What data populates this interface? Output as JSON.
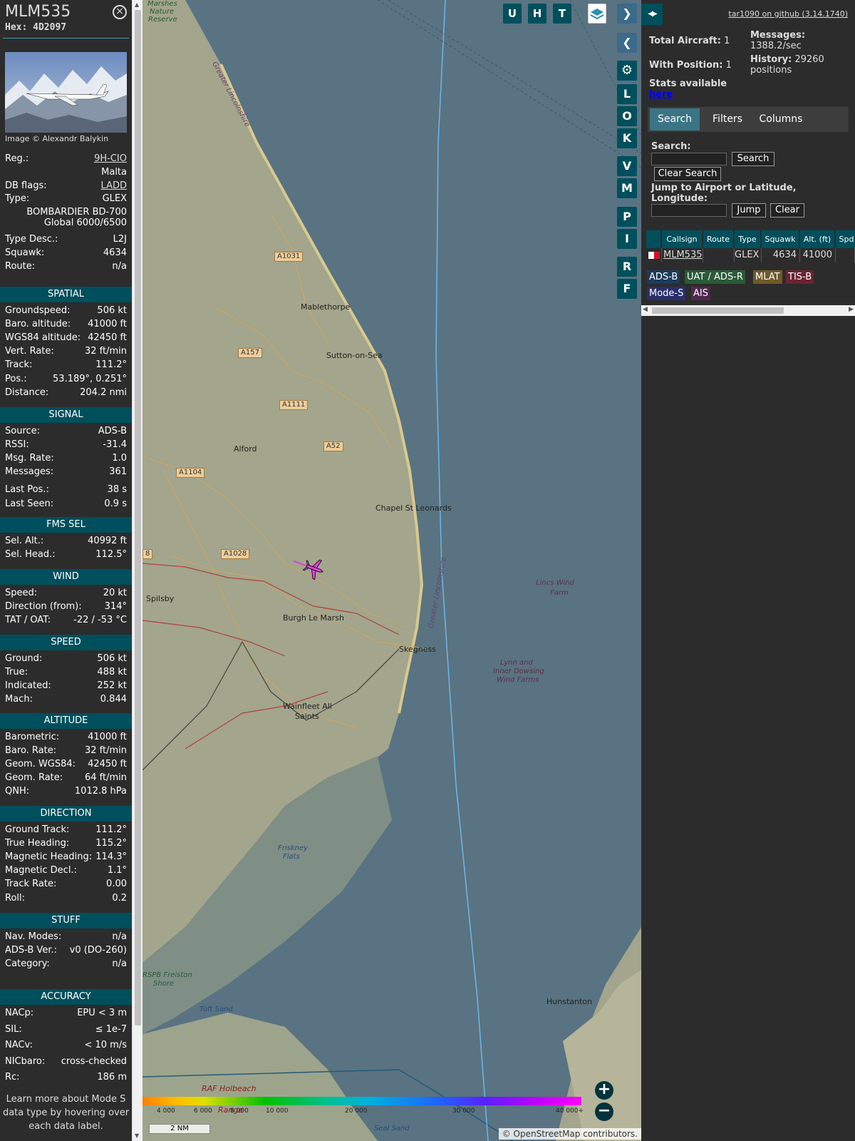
{
  "aircraft": {
    "callsign": "MLM535",
    "hex_label": "Hex:",
    "hex": "4D2097",
    "close_glyph": "×",
    "image_credit": "Image © Alexandr Balykin",
    "reg_label": "Reg.:",
    "reg": "9H-CIO",
    "country": "Malta",
    "dbflags_label": "DB flags:",
    "dbflags": "LADD",
    "type_label": "Type:",
    "type": "GLEX",
    "type_full_1": "BOMBARDIER BD-700",
    "type_full_2": "Global 6000/6500",
    "type_desc_label": "Type Desc.:",
    "type_desc": "L2J",
    "squawk_label": "Squawk:",
    "squawk": "4634",
    "route_label": "Route:",
    "route": "n/a"
  },
  "sections": {
    "spatial": {
      "title": "SPATIAL",
      "rows": [
        {
          "k": "Groundspeed:",
          "v": "506 kt"
        },
        {
          "k": "Baro. altitude:",
          "v": "41000 ft"
        },
        {
          "k": "WGS84 altitude:",
          "v": "42450 ft"
        },
        {
          "k": "Vert. Rate:",
          "v": "32 ft/min"
        },
        {
          "k": "Track:",
          "v": "111.2°"
        },
        {
          "k": "Pos.:",
          "v": "53.189°, 0.251°"
        },
        {
          "k": "Distance:",
          "v": "204.2 nmi"
        }
      ]
    },
    "signal": {
      "title": "SIGNAL",
      "rows": [
        {
          "k": "Source:",
          "v": "ADS-B"
        },
        {
          "k": "RSSI:",
          "v": "-31.4"
        },
        {
          "k": "Msg. Rate:",
          "v": "1.0"
        },
        {
          "k": "Messages:",
          "v": "361"
        },
        {
          "k": "Last Pos.:",
          "v": "38 s"
        },
        {
          "k": "Last Seen:",
          "v": "0.9 s"
        }
      ]
    },
    "fms": {
      "title": "FMS SEL",
      "rows": [
        {
          "k": "Sel. Alt.:",
          "v": "40992 ft"
        },
        {
          "k": "Sel. Head.:",
          "v": "112.5°"
        }
      ]
    },
    "wind": {
      "title": "WIND",
      "rows": [
        {
          "k": "Speed:",
          "v": "20 kt"
        },
        {
          "k": "Direction (from):",
          "v": "314°"
        },
        {
          "k": "TAT / OAT:",
          "v": "-22 / -53 °C"
        }
      ]
    },
    "speed": {
      "title": "SPEED",
      "rows": [
        {
          "k": "Ground:",
          "v": "506 kt"
        },
        {
          "k": "True:",
          "v": "488 kt"
        },
        {
          "k": "Indicated:",
          "v": "252 kt"
        },
        {
          "k": "Mach:",
          "v": "0.844"
        }
      ]
    },
    "altitude": {
      "title": "ALTITUDE",
      "rows": [
        {
          "k": "Barometric:",
          "v": "41000 ft"
        },
        {
          "k": "Baro. Rate:",
          "v": "32 ft/min"
        },
        {
          "k": "Geom. WGS84:",
          "v": "42450 ft"
        },
        {
          "k": "Geom. Rate:",
          "v": "64 ft/min"
        },
        {
          "k": "QNH:",
          "v": "1012.8 hPa"
        }
      ]
    },
    "direction": {
      "title": "DIRECTION",
      "rows": [
        {
          "k": "Ground Track:",
          "v": "111.2°"
        },
        {
          "k": "True Heading:",
          "v": "115.2°"
        },
        {
          "k": "Magnetic Heading:",
          "v": "114.3°"
        },
        {
          "k": "Magnetic Decl.:",
          "v": "1.1°"
        },
        {
          "k": "Track Rate:",
          "v": "0.00"
        },
        {
          "k": "Roll:",
          "v": "0.2"
        }
      ]
    },
    "stuff": {
      "title": "STUFF",
      "rows": [
        {
          "k": "Nav. Modes:",
          "v": "n/a"
        },
        {
          "k": "ADS-B Ver.:",
          "v": "v0 (DO-260)"
        },
        {
          "k": "Category:",
          "v": "n/a"
        }
      ]
    },
    "accuracy": {
      "title": "ACCURACY",
      "rows": [
        {
          "k": "NACp:",
          "v": "EPU < 3 m"
        },
        {
          "k": "SIL:",
          "v": "≤ 1e-7"
        },
        {
          "k": "NACv:",
          "v": "< 10 m/s"
        },
        {
          "k": "NICbaro:",
          "v": "cross-checked"
        },
        {
          "k": "Rc:",
          "v": "186 m"
        }
      ]
    }
  },
  "learn_more": "Learn more about Mode S data type by hovering over each data label.",
  "map": {
    "places": [
      "Mablethorpe",
      "Sutton-on-Sea",
      "Alford",
      "Chapel St Leonards",
      "Spilsby",
      "Burgh Le Marsh",
      "Skegness",
      "Wainfleet All",
      "Saints",
      "Hunstanton",
      "RAF Holbeach",
      "Range"
    ],
    "roads": [
      "A1031",
      "A157",
      "A1111",
      "A52",
      "A1104",
      "A1028",
      "8"
    ],
    "water": [
      "Lincs Wind",
      "Farm",
      "Lynn and",
      "Inner Dowsing",
      "Wind Farms",
      "Friskney",
      "Flats",
      "Toft Sand",
      "Seal Sand",
      "Marshes",
      "Nature",
      "Reserve",
      "RSPB Freiston",
      "Shore"
    ],
    "boundary": [
      "Greater Lincolnshire",
      "Greater Lincolnshire"
    ],
    "attribution": "© OpenStreetMap contributors.",
    "scale": "2 NM",
    "alt_ticks": [
      "4 000",
      "6 000",
      "8 000",
      "10 000",
      "20 000",
      "30 000",
      "40 000+"
    ],
    "zoom_in": "+",
    "zoom_out": "−"
  },
  "toolbar": {
    "top_buttons": [
      "U",
      "H",
      "T"
    ],
    "side_buttons": [
      "L",
      "O",
      "K",
      "V",
      "M",
      "P",
      "I",
      "R",
      "F"
    ],
    "next_glyph": "❯",
    "prev_glyph": "❮",
    "settings_glyph": "⚙",
    "expand_glyph": "◀▶"
  },
  "panel": {
    "github": "tar1090 on github (3.14.1740)",
    "total_label": "Total Aircraft:",
    "total": "1",
    "withpos_label": "With Position:",
    "withpos": "1",
    "messages_label": "Messages:",
    "messages": "1388.2/sec",
    "history_label": "History:",
    "history": "29260 positions",
    "stats_label": "Stats available",
    "stats_link": "here",
    "tabs": [
      "Search",
      "Filters",
      "Columns"
    ],
    "search_label": "Search:",
    "search_btn": "Search",
    "clear_search_btn": "Clear Search",
    "jump_label": "Jump to Airport or Latitude, Longitude:",
    "jump_btn": "Jump",
    "clear_btn": "Clear",
    "columns": [
      "Callsign",
      "Route",
      "Type",
      "Squawk",
      "Alt. (ft)",
      "Spd"
    ],
    "row": {
      "callsign": "MLM535",
      "route": "",
      "type": "GLEX",
      "squawk": "4634",
      "alt": "41000",
      "spd": ""
    },
    "legend": [
      {
        "label": "ADS-B",
        "color": "#1b3b5c"
      },
      {
        "label": "UAT / ADS-R",
        "color": "#2a5a37"
      },
      {
        "label": "MLAT",
        "color": "#6e5a2a"
      },
      {
        "label": "TIS-B",
        "color": "#6a2432"
      },
      {
        "label": "Mode-S",
        "color": "#2a2f6b"
      },
      {
        "label": "AIS",
        "color": "#4e2850"
      }
    ]
  },
  "colors": {
    "accent": "#004f5c",
    "map_sea": "#597382",
    "land": "#a3a58c",
    "track": "#6fb6e8",
    "plane": "#e040e0"
  }
}
